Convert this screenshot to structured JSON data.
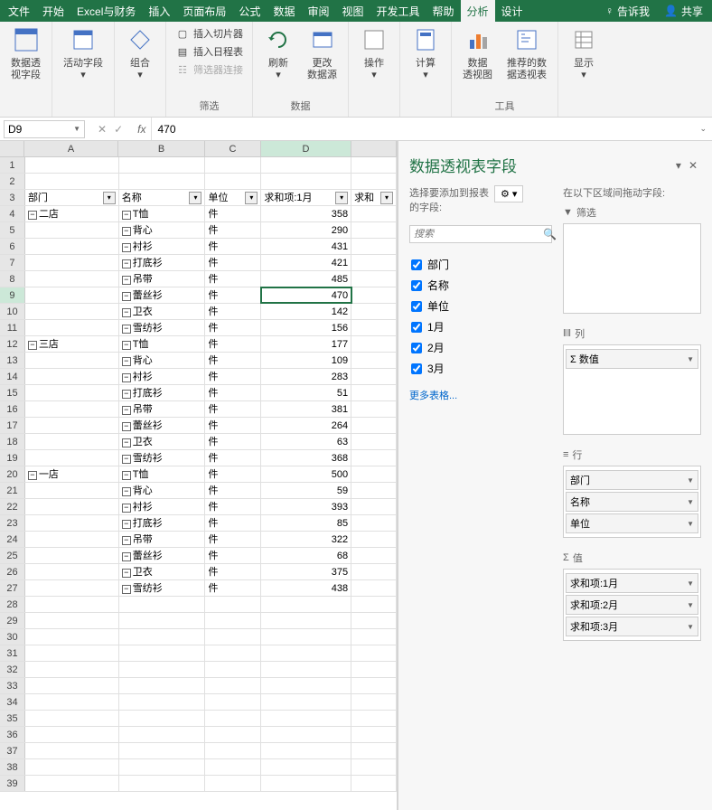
{
  "menu": {
    "tabs": [
      "文件",
      "开始",
      "Excel与财务",
      "插入",
      "页面布局",
      "公式",
      "数据",
      "审阅",
      "视图",
      "开发工具",
      "帮助",
      "分析",
      "设计"
    ],
    "active": "分析",
    "tell_me": "告诉我",
    "share": "共享"
  },
  "ribbon": {
    "pivot_field": "数据透\n视字段",
    "active_field": "活动字段",
    "group": "组合",
    "insert_slicer": "插入切片器",
    "insert_timeline": "插入日程表",
    "filter_conn": "筛选器连接",
    "filter_group": "筛选",
    "refresh": "刷新",
    "change_source": "更改\n数据源",
    "data_group": "数据",
    "actions": "操作",
    "calc": "计算",
    "pivot_chart": "数据\n透视图",
    "rec_pivot": "推荐的数\n据透视表",
    "tools_group": "工具",
    "show": "显示"
  },
  "namebox": "D9",
  "formula": "470",
  "columns": [
    "A",
    "B",
    "C",
    "D"
  ],
  "pivot_headers": {
    "a": "部门",
    "b": "名称",
    "c": "单位",
    "d": "求和项:1月",
    "e": "求和"
  },
  "active_cell": {
    "row": 9,
    "col": "D"
  },
  "pivot_rows": [
    {
      "r": 4,
      "dept": "二店",
      "name": "T恤",
      "unit": "件",
      "val": 358
    },
    {
      "r": 5,
      "dept": "",
      "name": "背心",
      "unit": "件",
      "val": 290
    },
    {
      "r": 6,
      "dept": "",
      "name": "衬衫",
      "unit": "件",
      "val": 431
    },
    {
      "r": 7,
      "dept": "",
      "name": "打底衫",
      "unit": "件",
      "val": 421
    },
    {
      "r": 8,
      "dept": "",
      "name": "吊带",
      "unit": "件",
      "val": 485
    },
    {
      "r": 9,
      "dept": "",
      "name": "蕾丝衫",
      "unit": "件",
      "val": 470
    },
    {
      "r": 10,
      "dept": "",
      "name": "卫衣",
      "unit": "件",
      "val": 142
    },
    {
      "r": 11,
      "dept": "",
      "name": "雪纺衫",
      "unit": "件",
      "val": 156
    },
    {
      "r": 12,
      "dept": "三店",
      "name": "T恤",
      "unit": "件",
      "val": 177
    },
    {
      "r": 13,
      "dept": "",
      "name": "背心",
      "unit": "件",
      "val": 109
    },
    {
      "r": 14,
      "dept": "",
      "name": "衬衫",
      "unit": "件",
      "val": 283
    },
    {
      "r": 15,
      "dept": "",
      "name": "打底衫",
      "unit": "件",
      "val": 51
    },
    {
      "r": 16,
      "dept": "",
      "name": "吊带",
      "unit": "件",
      "val": 381
    },
    {
      "r": 17,
      "dept": "",
      "name": "蕾丝衫",
      "unit": "件",
      "val": 264
    },
    {
      "r": 18,
      "dept": "",
      "name": "卫衣",
      "unit": "件",
      "val": 63
    },
    {
      "r": 19,
      "dept": "",
      "name": "雪纺衫",
      "unit": "件",
      "val": 368
    },
    {
      "r": 20,
      "dept": "一店",
      "name": "T恤",
      "unit": "件",
      "val": 500
    },
    {
      "r": 21,
      "dept": "",
      "name": "背心",
      "unit": "件",
      "val": 59
    },
    {
      "r": 22,
      "dept": "",
      "name": "衬衫",
      "unit": "件",
      "val": 393
    },
    {
      "r": 23,
      "dept": "",
      "name": "打底衫",
      "unit": "件",
      "val": 85
    },
    {
      "r": 24,
      "dept": "",
      "name": "吊带",
      "unit": "件",
      "val": 322
    },
    {
      "r": 25,
      "dept": "",
      "name": "蕾丝衫",
      "unit": "件",
      "val": 68
    },
    {
      "r": 26,
      "dept": "",
      "name": "卫衣",
      "unit": "件",
      "val": 375
    },
    {
      "r": 27,
      "dept": "",
      "name": "雪纺衫",
      "unit": "件",
      "val": 438
    }
  ],
  "empty_rows": [
    1,
    2,
    28,
    29,
    30,
    31,
    32,
    33,
    34,
    35,
    36,
    37,
    38,
    39
  ],
  "panel": {
    "title": "数据透视表字段",
    "choose_label": "选择要添加到报表\n的字段:",
    "drag_label": "在以下区域间拖动字段:",
    "search_placeholder": "搜索",
    "fields": [
      "部门",
      "名称",
      "单位",
      "1月",
      "2月",
      "3月"
    ],
    "more_tables": "更多表格...",
    "filters_label": "筛选",
    "columns_label": "列",
    "rows_label": "行",
    "values_label": "值",
    "columns_items": [
      "Σ 数值"
    ],
    "rows_items": [
      "部门",
      "名称",
      "单位"
    ],
    "values_items": [
      "求和项:1月",
      "求和项:2月",
      "求和项:3月"
    ]
  }
}
